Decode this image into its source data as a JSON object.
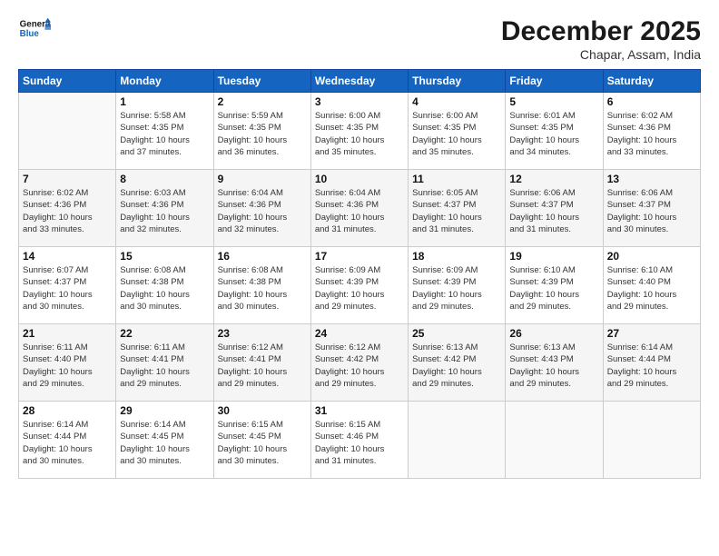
{
  "logo": {
    "line1": "General",
    "line2": "Blue"
  },
  "title": "December 2025",
  "subtitle": "Chapar, Assam, India",
  "weekdays": [
    "Sunday",
    "Monday",
    "Tuesday",
    "Wednesday",
    "Thursday",
    "Friday",
    "Saturday"
  ],
  "weeks": [
    [
      {
        "day": "",
        "info": ""
      },
      {
        "day": "1",
        "info": "Sunrise: 5:58 AM\nSunset: 4:35 PM\nDaylight: 10 hours\nand 37 minutes."
      },
      {
        "day": "2",
        "info": "Sunrise: 5:59 AM\nSunset: 4:35 PM\nDaylight: 10 hours\nand 36 minutes."
      },
      {
        "day": "3",
        "info": "Sunrise: 6:00 AM\nSunset: 4:35 PM\nDaylight: 10 hours\nand 35 minutes."
      },
      {
        "day": "4",
        "info": "Sunrise: 6:00 AM\nSunset: 4:35 PM\nDaylight: 10 hours\nand 35 minutes."
      },
      {
        "day": "5",
        "info": "Sunrise: 6:01 AM\nSunset: 4:35 PM\nDaylight: 10 hours\nand 34 minutes."
      },
      {
        "day": "6",
        "info": "Sunrise: 6:02 AM\nSunset: 4:36 PM\nDaylight: 10 hours\nand 33 minutes."
      }
    ],
    [
      {
        "day": "7",
        "info": "Sunrise: 6:02 AM\nSunset: 4:36 PM\nDaylight: 10 hours\nand 33 minutes."
      },
      {
        "day": "8",
        "info": "Sunrise: 6:03 AM\nSunset: 4:36 PM\nDaylight: 10 hours\nand 32 minutes."
      },
      {
        "day": "9",
        "info": "Sunrise: 6:04 AM\nSunset: 4:36 PM\nDaylight: 10 hours\nand 32 minutes."
      },
      {
        "day": "10",
        "info": "Sunrise: 6:04 AM\nSunset: 4:36 PM\nDaylight: 10 hours\nand 31 minutes."
      },
      {
        "day": "11",
        "info": "Sunrise: 6:05 AM\nSunset: 4:37 PM\nDaylight: 10 hours\nand 31 minutes."
      },
      {
        "day": "12",
        "info": "Sunrise: 6:06 AM\nSunset: 4:37 PM\nDaylight: 10 hours\nand 31 minutes."
      },
      {
        "day": "13",
        "info": "Sunrise: 6:06 AM\nSunset: 4:37 PM\nDaylight: 10 hours\nand 30 minutes."
      }
    ],
    [
      {
        "day": "14",
        "info": "Sunrise: 6:07 AM\nSunset: 4:37 PM\nDaylight: 10 hours\nand 30 minutes."
      },
      {
        "day": "15",
        "info": "Sunrise: 6:08 AM\nSunset: 4:38 PM\nDaylight: 10 hours\nand 30 minutes."
      },
      {
        "day": "16",
        "info": "Sunrise: 6:08 AM\nSunset: 4:38 PM\nDaylight: 10 hours\nand 30 minutes."
      },
      {
        "day": "17",
        "info": "Sunrise: 6:09 AM\nSunset: 4:39 PM\nDaylight: 10 hours\nand 29 minutes."
      },
      {
        "day": "18",
        "info": "Sunrise: 6:09 AM\nSunset: 4:39 PM\nDaylight: 10 hours\nand 29 minutes."
      },
      {
        "day": "19",
        "info": "Sunrise: 6:10 AM\nSunset: 4:39 PM\nDaylight: 10 hours\nand 29 minutes."
      },
      {
        "day": "20",
        "info": "Sunrise: 6:10 AM\nSunset: 4:40 PM\nDaylight: 10 hours\nand 29 minutes."
      }
    ],
    [
      {
        "day": "21",
        "info": "Sunrise: 6:11 AM\nSunset: 4:40 PM\nDaylight: 10 hours\nand 29 minutes."
      },
      {
        "day": "22",
        "info": "Sunrise: 6:11 AM\nSunset: 4:41 PM\nDaylight: 10 hours\nand 29 minutes."
      },
      {
        "day": "23",
        "info": "Sunrise: 6:12 AM\nSunset: 4:41 PM\nDaylight: 10 hours\nand 29 minutes."
      },
      {
        "day": "24",
        "info": "Sunrise: 6:12 AM\nSunset: 4:42 PM\nDaylight: 10 hours\nand 29 minutes."
      },
      {
        "day": "25",
        "info": "Sunrise: 6:13 AM\nSunset: 4:42 PM\nDaylight: 10 hours\nand 29 minutes."
      },
      {
        "day": "26",
        "info": "Sunrise: 6:13 AM\nSunset: 4:43 PM\nDaylight: 10 hours\nand 29 minutes."
      },
      {
        "day": "27",
        "info": "Sunrise: 6:14 AM\nSunset: 4:44 PM\nDaylight: 10 hours\nand 29 minutes."
      }
    ],
    [
      {
        "day": "28",
        "info": "Sunrise: 6:14 AM\nSunset: 4:44 PM\nDaylight: 10 hours\nand 30 minutes."
      },
      {
        "day": "29",
        "info": "Sunrise: 6:14 AM\nSunset: 4:45 PM\nDaylight: 10 hours\nand 30 minutes."
      },
      {
        "day": "30",
        "info": "Sunrise: 6:15 AM\nSunset: 4:45 PM\nDaylight: 10 hours\nand 30 minutes."
      },
      {
        "day": "31",
        "info": "Sunrise: 6:15 AM\nSunset: 4:46 PM\nDaylight: 10 hours\nand 31 minutes."
      },
      {
        "day": "",
        "info": ""
      },
      {
        "day": "",
        "info": ""
      },
      {
        "day": "",
        "info": ""
      }
    ]
  ]
}
